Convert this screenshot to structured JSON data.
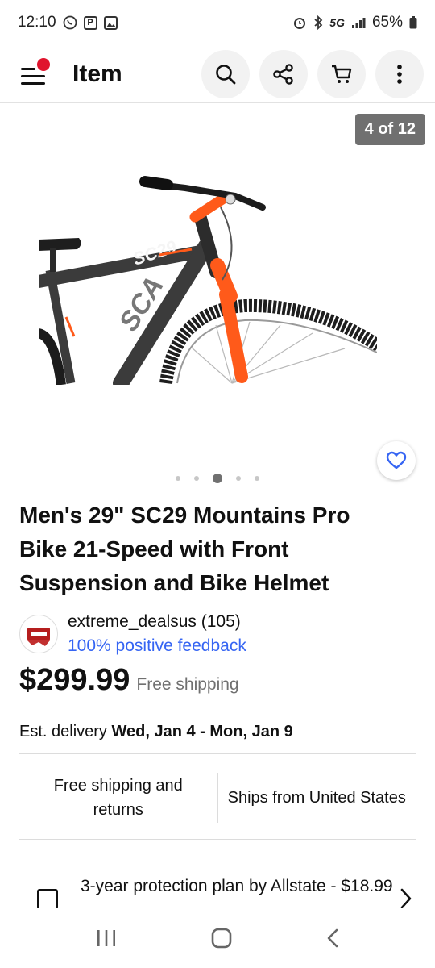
{
  "status": {
    "time": "12:10",
    "network": "5G",
    "battery": "65%"
  },
  "header": {
    "title": "Item"
  },
  "gallery": {
    "counter": "4 of 12",
    "dots": 5,
    "active_dot": 3
  },
  "listing": {
    "title": "Men's 29\" SC29 Mountains Pro Bike 21-Speed with Front Suspension and Bike Helmet",
    "seller_name": "extreme_dealsus (105)",
    "seller_feedback": "100% positive feedback",
    "price": "$299.99",
    "shipping": "Free shipping",
    "delivery_label": "Est. delivery ",
    "delivery_dates": "Wed, Jan 4 - Mon, Jan 9"
  },
  "info": {
    "left": "Free shipping and returns",
    "right": "Ships from United States"
  },
  "protection": {
    "label": "3-year protection plan by Allstate - $18.99"
  },
  "colors": {
    "accent": "#3665f3",
    "notification": "#e0142d",
    "bike_orange": "#ff5a1a"
  },
  "icons": [
    "whatsapp-icon",
    "parking-icon",
    "gallery-icon",
    "alarm-icon",
    "bluetooth-icon",
    "signal-icon",
    "battery-icon",
    "search-icon",
    "share-icon",
    "cart-icon",
    "more-icon",
    "heart-icon",
    "chevron-right-icon",
    "recents-icon",
    "home-icon",
    "back-icon"
  ]
}
